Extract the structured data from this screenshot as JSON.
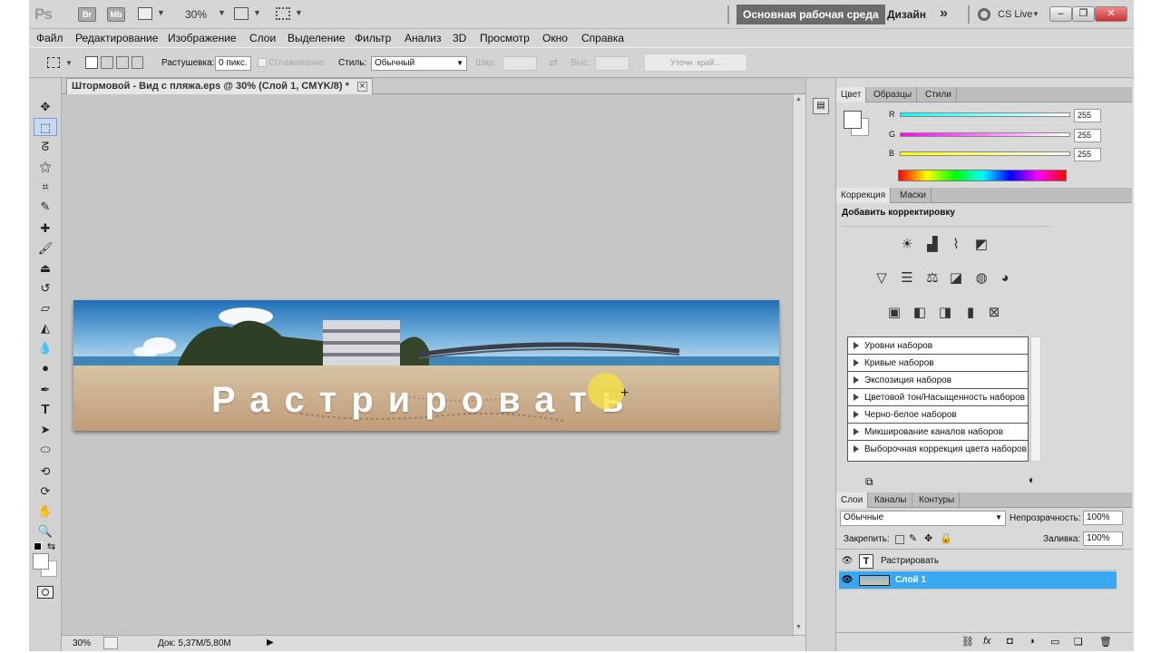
{
  "appbar": {
    "logo": "Ps",
    "bridge": "Br",
    "minibridge": "Mb",
    "zoom": "30%",
    "workspace_active": "Основная рабочая среда",
    "workspace_design": "Дизайн",
    "more": "»",
    "cslive": "CS Live",
    "win_min": "–",
    "win_max": "❐",
    "win_close": "✕"
  },
  "menu": {
    "items": [
      "Файл",
      "Редактирование",
      "Изображение",
      "Слои",
      "Выделение",
      "Фильтр",
      "Анализ",
      "3D",
      "Просмотр",
      "Окно",
      "Справка"
    ]
  },
  "options": {
    "feather_label": "Растушевка:",
    "feather_value": "0 пикс.",
    "antialias_label": "Сглаживание",
    "style_label": "Стиль:",
    "style_value": "Обычный",
    "width_label": "Шир.:",
    "height_label": "Выс.:",
    "refine_edge": "Уточн. край..."
  },
  "document": {
    "tab_title": "Штормовой - Вид с пляжа.eps @ 30% (Слой 1, CMYK/8) *",
    "tab_close": "×",
    "overlay_text": "Растрировать",
    "status_zoom": "30%",
    "status_doc": "Док: 5,37M/5,80M"
  },
  "color_panel": {
    "tabs": [
      "Цвет",
      "Образцы",
      "Стили"
    ],
    "r_label": "R",
    "g_label": "G",
    "b_label": "B",
    "r_value": "255",
    "g_value": "255",
    "b_value": "255"
  },
  "adjustments_panel": {
    "tabs": [
      "Коррекция",
      "Маски"
    ],
    "title": "Добавить корректировку",
    "presets": [
      "Уровни наборов",
      "Кривые наборов",
      "Экспозиция наборов",
      "Цветовой тон/Насыщенность наборов",
      "Черно-белое наборов",
      "Микширование каналов наборов",
      "Выборочная коррекция цвета наборов"
    ]
  },
  "layers_panel": {
    "tabs": [
      "Слои",
      "Каналы",
      "Контуры"
    ],
    "blend_mode": "Обычные",
    "opacity_label": "Непрозрачность:",
    "opacity_value": "100%",
    "lock_label": "Закрепить:",
    "fill_label": "Заливка:",
    "fill_value": "100%",
    "layers": [
      {
        "name": "Растрировать",
        "thumb": "T"
      },
      {
        "name": "Слой 1",
        "thumb": ""
      }
    ]
  },
  "colors": {
    "selected_layer": "#3aa8f0",
    "workspace_bg": "#c6c6c6"
  }
}
